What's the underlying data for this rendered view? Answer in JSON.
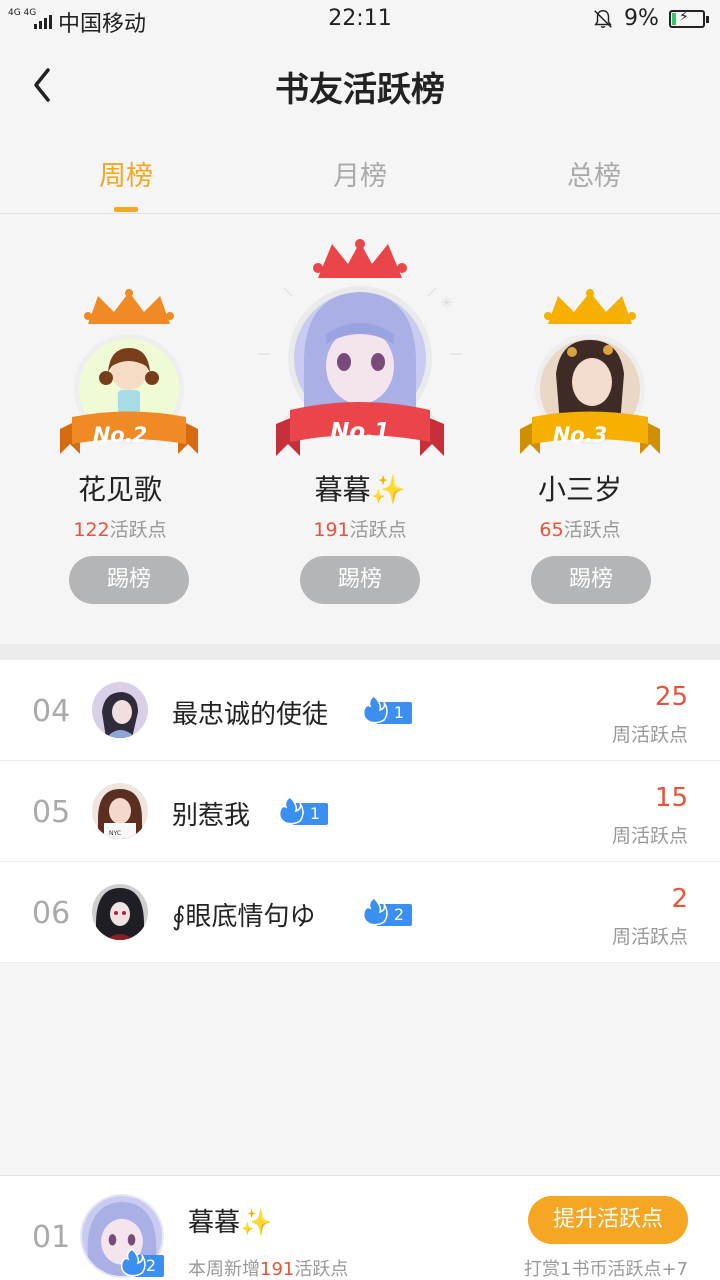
{
  "status_bar": {
    "signal": "4G 4G",
    "carrier": "中国移动",
    "time": "22:11",
    "battery": "9%"
  },
  "header": {
    "title": "书友活跃榜"
  },
  "tabs": [
    {
      "label": "周榜",
      "active": true
    },
    {
      "label": "月榜",
      "active": false
    },
    {
      "label": "总榜",
      "active": false
    }
  ],
  "podium": {
    "first": {
      "badge": "No.1",
      "name": "暮暮✨",
      "points": "191",
      "points_label": "活跃点",
      "button": "踢榜"
    },
    "second": {
      "badge": "No.2",
      "name": "花见歌",
      "points": "122",
      "points_label": "活跃点",
      "button": "踢榜"
    },
    "third": {
      "badge": "No.3",
      "name": "小三岁",
      "points": "65",
      "points_label": "活跃点",
      "button": "踢榜"
    }
  },
  "list": [
    {
      "rank": "04",
      "name": "最忠诚的使徒",
      "level": "1",
      "score": "25",
      "score_label": "周活跃点"
    },
    {
      "rank": "05",
      "name": "别惹我",
      "level": "1",
      "score": "15",
      "score_label": "周活跃点"
    },
    {
      "rank": "06",
      "name": "∮眼底情句ゆ",
      "level": "2",
      "score": "2",
      "score_label": "周活跃点"
    }
  ],
  "me": {
    "rank": "01",
    "name": "暮暮✨",
    "level": "2",
    "sub_prefix": "本周新增",
    "sub_points": "191",
    "sub_suffix": "活跃点",
    "button": "提升活跃点",
    "hint": "打赏1书币活跃点+7"
  },
  "colors": {
    "accent": "#f5a623",
    "score": "#e8533d",
    "level_badge": "#3b8ff0",
    "kick_button": "#b3b5b7",
    "no1_ribbon": "#e8474c",
    "no2_ribbon": "#f08a24",
    "no3_ribbon": "#f5b000"
  }
}
